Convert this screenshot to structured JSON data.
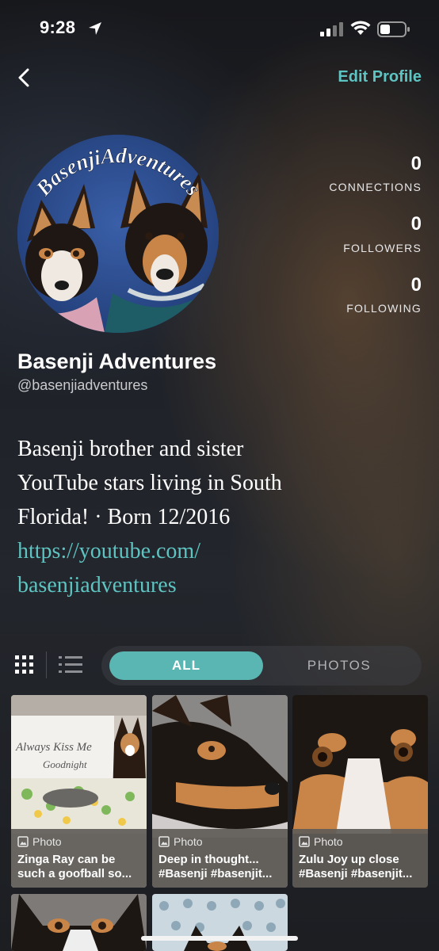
{
  "status": {
    "time": "9:28"
  },
  "header": {
    "edit_label": "Edit Profile"
  },
  "avatar": {
    "arc_text": "BasenjiAdventures"
  },
  "stats": [
    {
      "value": "0",
      "label": "CONNECTIONS"
    },
    {
      "value": "0",
      "label": "FOLLOWERS"
    },
    {
      "value": "0",
      "label": "FOLLOWING"
    }
  ],
  "profile": {
    "name": "Basenji Adventures",
    "handle": "@basenjiadventures",
    "bio_line1": "Basenji brother and sister",
    "bio_line2": "YouTube stars living in South",
    "bio_line3": "Florida!  · Born 12/2016",
    "link_line1": "https://youtube.com/",
    "link_line2": "basenjiadventures"
  },
  "filters": {
    "all": "ALL",
    "photos": "PHOTOS"
  },
  "posts": [
    {
      "type": "Photo",
      "caption_l1": "Zinga Ray can be",
      "caption_l2": "such a goofball so...",
      "photo_text_1": "Always Kiss Me",
      "photo_text_2": "Goodnight"
    },
    {
      "type": "Photo",
      "caption_l1": "Deep in thought...",
      "caption_l2": "#Basenji #basenjit..."
    },
    {
      "type": "Photo",
      "caption_l1": "Zulu Joy up close",
      "caption_l2": "#Basenji #basenjit..."
    }
  ],
  "icons": {
    "location": "location-arrow-icon",
    "signal": "cellular-signal-icon",
    "wifi": "wifi-icon",
    "battery": "battery-icon",
    "back": "chevron-left-icon",
    "grid": "grid-view-icon",
    "list": "list-view-icon",
    "photo": "photo-icon"
  },
  "colors": {
    "accent": "#5ec4c2",
    "tab_active": "#5ab6b3"
  }
}
